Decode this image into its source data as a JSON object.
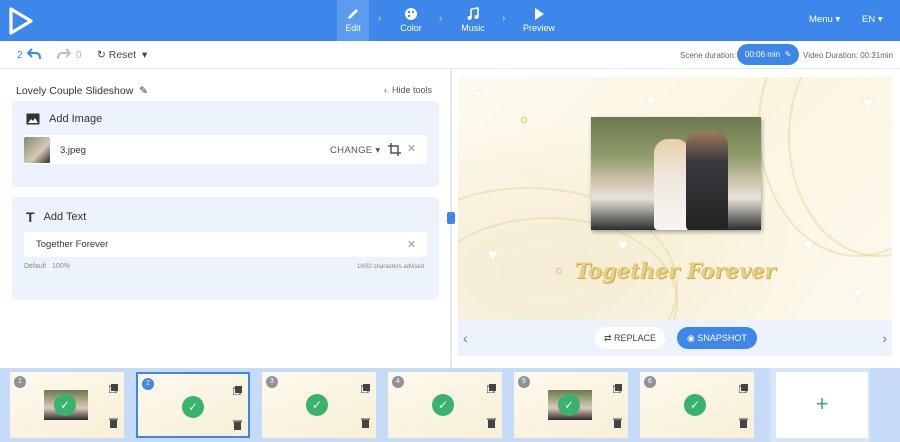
{
  "nav": {
    "items": [
      {
        "label": "Edit",
        "icon": "pencil-icon"
      },
      {
        "label": "Color",
        "icon": "palette-icon"
      },
      {
        "label": "Music",
        "icon": "music-note-icon"
      },
      {
        "label": "Preview",
        "icon": "play-icon"
      }
    ],
    "menu_label": "Menu",
    "lang_label": "EN"
  },
  "toolbar": {
    "undo_count": "2",
    "redo_count": "0",
    "reset_label": "Reset",
    "scene_duration_label": "Scene duration:",
    "scene_duration_value": "00:06 min",
    "video_duration": "Video Duration: 00:31min"
  },
  "editor": {
    "project_title": "Lovely Couple Slideshow",
    "hide_tools_label": "Hide tools",
    "add_image": {
      "heading": "Add Image",
      "file_name": "3.jpeg",
      "change_label": "CHANGE"
    },
    "add_text": {
      "heading": "Add Text",
      "value": "Together Forever",
      "style_label": "Default",
      "size_label": "100%",
      "char_count": "16/82 characters advised"
    }
  },
  "preview": {
    "title_text": "Together Forever",
    "replace_label": "REPLACE",
    "snapshot_label": "SNAPSHOT"
  },
  "timeline": {
    "scenes": [
      {
        "num": "1"
      },
      {
        "num": "2"
      },
      {
        "num": "3"
      },
      {
        "num": "4"
      },
      {
        "num": "5"
      },
      {
        "num": "6"
      }
    ],
    "add_label": "+"
  },
  "colors": {
    "accent": "#3d87ea",
    "success": "#39b36b"
  }
}
